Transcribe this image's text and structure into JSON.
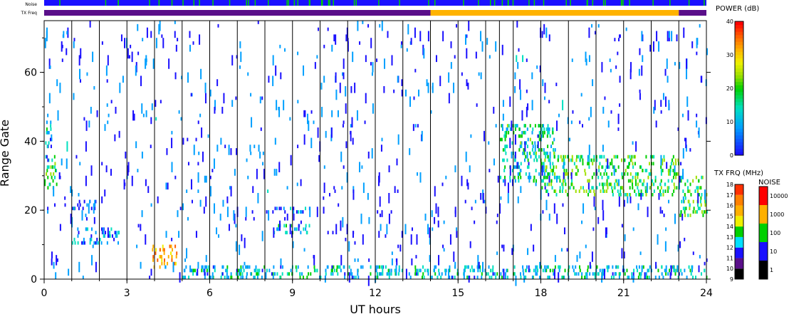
{
  "chart_data": {
    "type": "heatmap",
    "title": "",
    "xlabel": "UT hours",
    "ylabel": "Range Gate",
    "xlim": [
      0,
      24
    ],
    "ylim": [
      0,
      75
    ],
    "x_ticks": [
      0,
      3,
      6,
      9,
      12,
      15,
      18,
      21,
      24
    ],
    "y_ticks": [
      0,
      20,
      40,
      60
    ],
    "scan_boundaries_ut": [
      1,
      2,
      3,
      4,
      5,
      6,
      7,
      8,
      9,
      10,
      11,
      12,
      13,
      14,
      15,
      16,
      16.5,
      17,
      18,
      19,
      20,
      21,
      22,
      23
    ],
    "top_bars": {
      "noise_label": "Noise",
      "freq_label": "TX Freq",
      "freq_segments": [
        {
          "start": 0,
          "end": 14,
          "color": "#5a0f8a"
        },
        {
          "start": 14,
          "end": 23,
          "color": "#ffb300"
        },
        {
          "start": 23,
          "end": 24,
          "color": "#5a0f8a"
        }
      ]
    },
    "power_colorbar": {
      "label": "POWER (dB)",
      "ticks": [
        0,
        10,
        20,
        30,
        40
      ],
      "range": [
        0,
        40
      ],
      "colors": [
        "#1a10ff",
        "#00a0ff",
        "#00e0c0",
        "#00d000",
        "#a0e000",
        "#f0f000",
        "#ffb000",
        "#ff6000",
        "#ff0000"
      ]
    },
    "freq_colorbar": {
      "label": "TX FRQ (MHz)",
      "ticks": [
        9,
        10,
        11,
        12,
        13,
        14,
        15,
        16,
        17,
        18
      ],
      "colors": [
        "#000000",
        "#5a0f8a",
        "#1a10ff",
        "#00e0ff",
        "#00d000",
        "#f0f000",
        "#ffb000",
        "#ff8000",
        "#ff3000"
      ]
    },
    "noise_colorbar": {
      "label": "NOISE",
      "ticks": [
        "1",
        "10",
        "100",
        "1000",
        "10000"
      ],
      "colors": [
        "#000000",
        "#1a10ff",
        "#00d000",
        "#ffb000",
        "#ff0000"
      ]
    },
    "echo_regions": [
      {
        "t0": 0.0,
        "t1": 0.45,
        "g0": 25,
        "g1": 36,
        "power": 14
      },
      {
        "t0": 0.0,
        "t1": 0.3,
        "g0": 38,
        "g1": 48,
        "power": 8
      },
      {
        "t0": 1.0,
        "t1": 2.7,
        "g0": 10,
        "g1": 15,
        "power": 6
      },
      {
        "t0": 1.0,
        "t1": 1.9,
        "g0": 20,
        "g1": 23,
        "power": 4
      },
      {
        "t0": 3.9,
        "t1": 4.8,
        "g0": 3,
        "g1": 10,
        "power": 30
      },
      {
        "t0": 8.0,
        "t1": 9.6,
        "g0": 19,
        "g1": 21,
        "power": 5
      },
      {
        "t0": 8.3,
        "t1": 9.6,
        "g0": 13,
        "g1": 16,
        "power": 9
      },
      {
        "t0": 5.0,
        "t1": 24.0,
        "g0": 0,
        "g1": 4,
        "power": 10
      },
      {
        "t0": 16.5,
        "t1": 18.5,
        "g0": 28,
        "g1": 45,
        "power": 12
      },
      {
        "t0": 18.0,
        "t1": 23.0,
        "g0": 24,
        "g1": 36,
        "power": 15
      },
      {
        "t0": 23.0,
        "t1": 24.0,
        "g0": 18,
        "g1": 30,
        "power": 16
      }
    ]
  }
}
